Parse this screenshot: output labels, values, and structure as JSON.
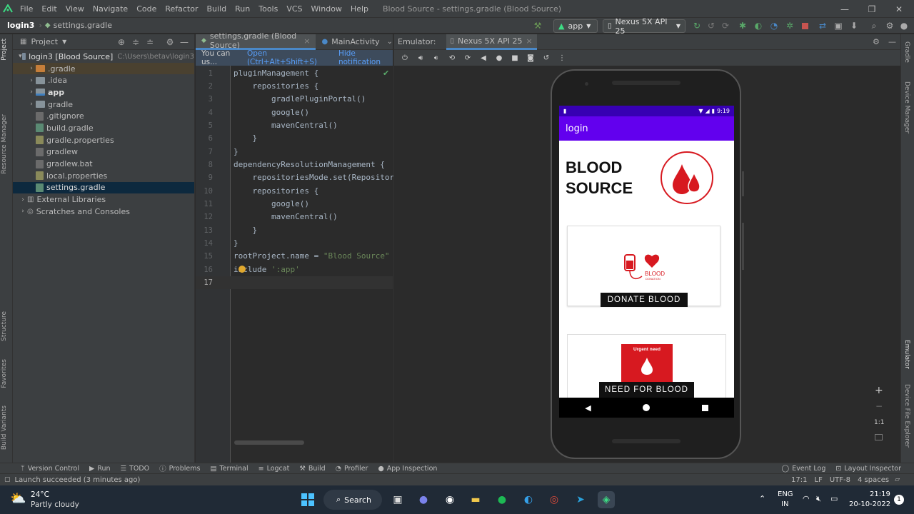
{
  "menubar": {
    "items": [
      "File",
      "Edit",
      "View",
      "Navigate",
      "Code",
      "Refactor",
      "Build",
      "Run",
      "Tools",
      "VCS",
      "Window",
      "Help"
    ],
    "title": "Blood Source - settings.gradle (Blood Source)"
  },
  "navbar": {
    "project": "login3",
    "file": "settings.gradle",
    "run_config": "app",
    "device": "Nexus 5X API 25"
  },
  "project_panel": {
    "title": "Project",
    "root_name": "login3 [Blood Source]",
    "root_path": "C:\\Users\\betav\\login3",
    "items": [
      ".gradle",
      ".idea",
      "app",
      "gradle",
      ".gitignore",
      "build.gradle",
      "gradle.properties",
      "gradlew",
      "gradlew.bat",
      "local.properties",
      "settings.gradle",
      "External Libraries",
      "Scratches and Consoles"
    ]
  },
  "editor": {
    "tabs": [
      "settings.gradle (Blood Source)",
      "MainActivity"
    ],
    "notice": "You can us...",
    "notice_link": "Open (Ctrl+Alt+Shift+S)",
    "notice_hide": "Hide notification",
    "line_numbers": [
      "1",
      "2",
      "3",
      "4",
      "5",
      "6",
      "7",
      "8",
      "9",
      "10",
      "11",
      "12",
      "13",
      "14",
      "15",
      "16",
      "17"
    ]
  },
  "emulator": {
    "label": "Emulator:",
    "device_tab": "Nexus 5X API 25",
    "status_time": "9:19",
    "app_title": "login",
    "heading_line1": "BLOOD",
    "heading_line2": "SOURCE",
    "donate_label": "DONATE BLOOD",
    "donation_word": "BLOOD",
    "donation_sub": "DONATION",
    "need_label": "NEED FOR BLOOD",
    "urgent_text": "Urgent need",
    "zoom_controls": [
      "+",
      "−",
      "1:1"
    ]
  },
  "sidebars": {
    "left": [
      "Project",
      "Resource Manager",
      "Structure",
      "Favorites",
      "Build Variants"
    ],
    "right": [
      "Gradle",
      "Device Manager",
      "Emulator",
      "Device File Explorer"
    ]
  },
  "bottom_tools": [
    "Version Control",
    "Run",
    "TODO",
    "Problems",
    "Terminal",
    "Logcat",
    "Build",
    "Profiler",
    "App Inspection"
  ],
  "bottom_right_tools": [
    "Event Log",
    "Layout Inspector"
  ],
  "status": {
    "message": "Launch succeeded (3 minutes ago)",
    "position": "17:1",
    "line_sep": "LF",
    "encoding": "UTF-8",
    "indent": "4 spaces"
  },
  "taskbar": {
    "temp": "24°C",
    "weather": "Partly cloudy",
    "search": "Search",
    "lang1": "ENG",
    "lang2": "IN",
    "time": "21:19",
    "date": "20-10-2022",
    "badge": "1"
  }
}
